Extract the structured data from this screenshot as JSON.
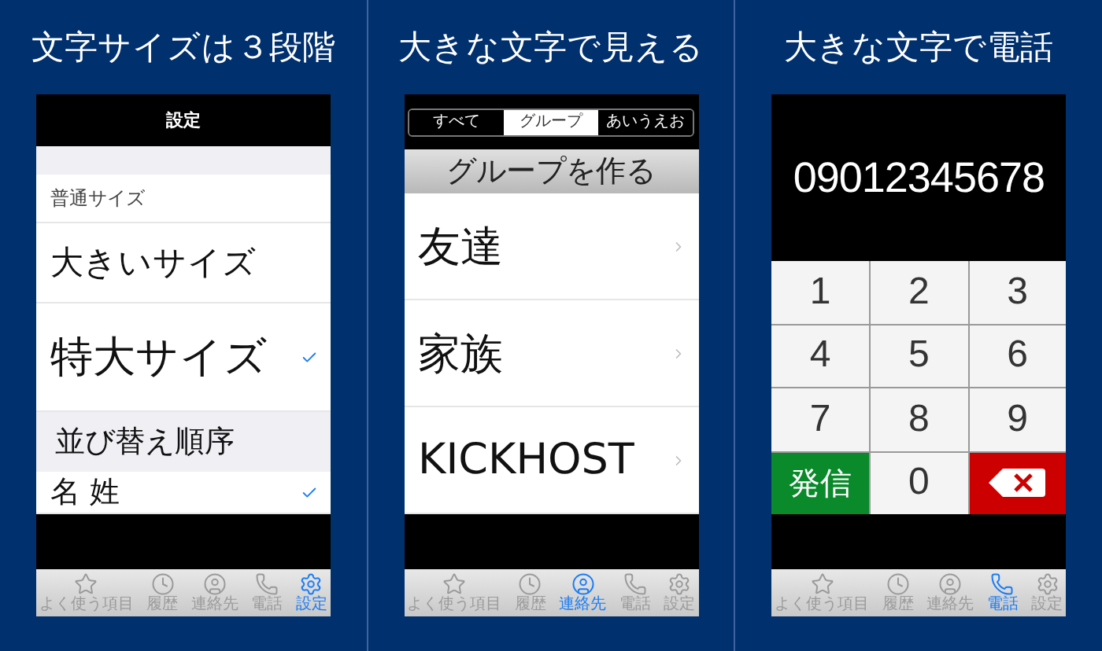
{
  "panels": [
    {
      "caption": "文字サイズは３段階",
      "screen": {
        "kind": "settings",
        "title": "設定",
        "size_options": [
          {
            "label": "普通サイズ",
            "selected": false
          },
          {
            "label": "大きいサイズ",
            "selected": false
          },
          {
            "label": "特大サイズ",
            "selected": true
          }
        ],
        "sort_section": "並び替え順序",
        "sort_options": [
          {
            "label": "名 姓",
            "selected": true
          }
        ]
      },
      "tab_bar": [
        {
          "label": "よく使う項目",
          "selected": false
        },
        {
          "label": "履歴",
          "selected": false
        },
        {
          "label": "連絡先",
          "selected": false
        },
        {
          "label": "電話",
          "selected": false
        },
        {
          "label": "設定",
          "selected": true
        }
      ]
    },
    {
      "caption": "大きな文字で見える",
      "screen": {
        "kind": "groups",
        "segments": [
          {
            "label": "すべて",
            "selected": false
          },
          {
            "label": "グループ",
            "selected": true
          },
          {
            "label": "あいうえお",
            "selected": false
          }
        ],
        "create_button": "グループを作る",
        "groups": [
          "友達",
          "家族",
          "KICKHOST"
        ]
      },
      "tab_bar": [
        {
          "label": "よく使う項目",
          "selected": false
        },
        {
          "label": "履歴",
          "selected": false
        },
        {
          "label": "連絡先",
          "selected": true
        },
        {
          "label": "電話",
          "selected": false
        },
        {
          "label": "設定",
          "selected": false
        }
      ]
    },
    {
      "caption": "大きな文字で電話",
      "screen": {
        "kind": "dialer",
        "number": "09012345678",
        "keys": [
          {
            "kind": "digit",
            "label": "1"
          },
          {
            "kind": "digit",
            "label": "2"
          },
          {
            "kind": "digit",
            "label": "3"
          },
          {
            "kind": "digit",
            "label": "4"
          },
          {
            "kind": "digit",
            "label": "5"
          },
          {
            "kind": "digit",
            "label": "6"
          },
          {
            "kind": "digit",
            "label": "7"
          },
          {
            "kind": "digit",
            "label": "8"
          },
          {
            "kind": "digit",
            "label": "9"
          },
          {
            "kind": "call",
            "label": "発信"
          },
          {
            "kind": "digit",
            "label": "0"
          },
          {
            "kind": "delete"
          }
        ]
      },
      "tab_bar": [
        {
          "label": "よく使う項目",
          "selected": false
        },
        {
          "label": "履歴",
          "selected": false
        },
        {
          "label": "連絡先",
          "selected": false
        },
        {
          "label": "電話",
          "selected": true
        },
        {
          "label": "設定",
          "selected": false
        }
      ]
    }
  ]
}
